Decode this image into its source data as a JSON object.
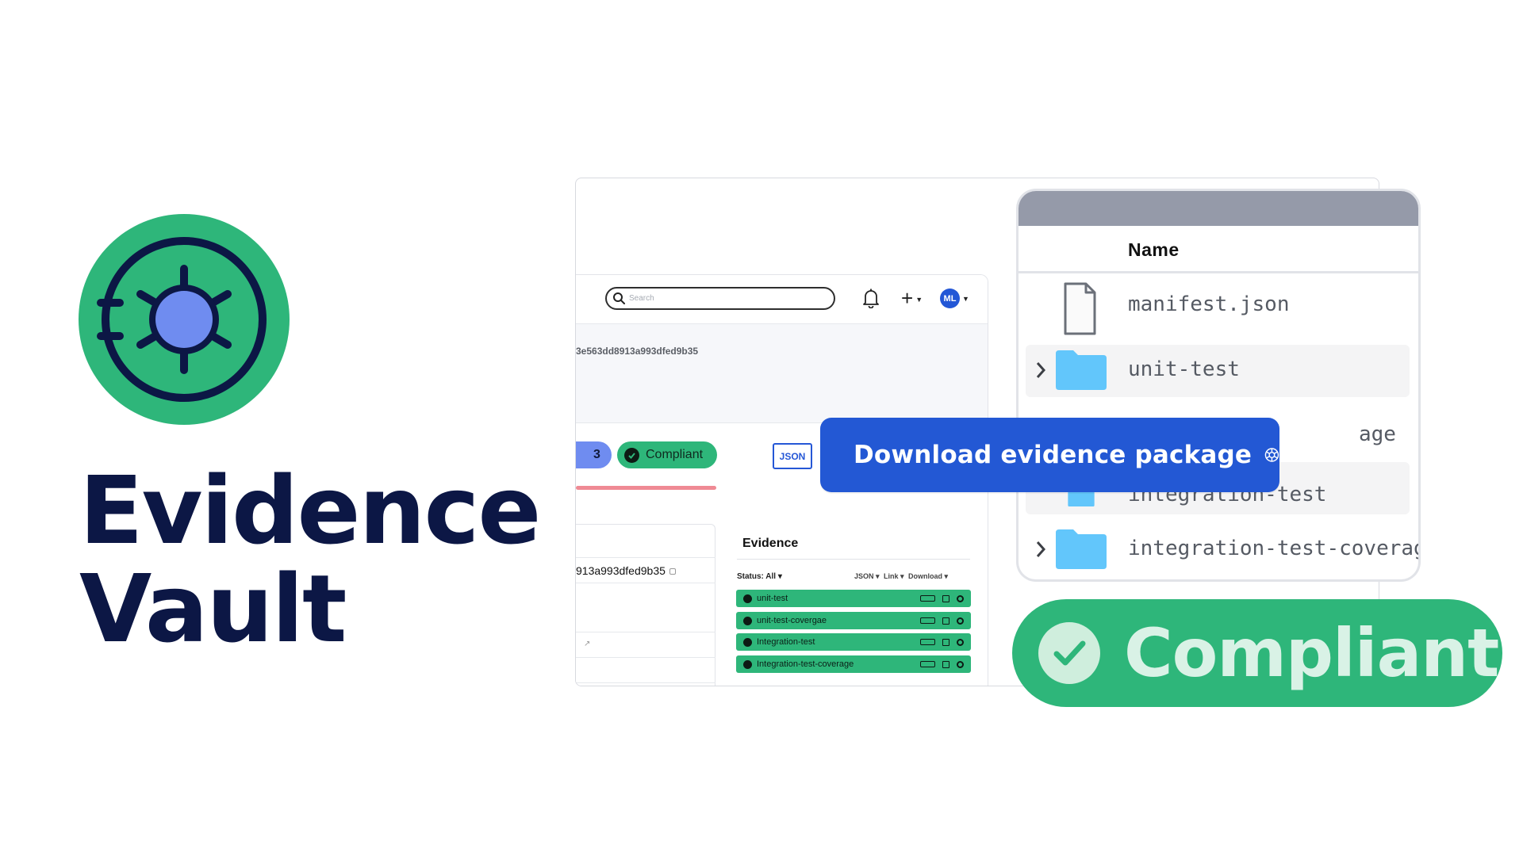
{
  "brand": {
    "title_line1": "Evidence",
    "title_line2": "Vault",
    "logo_icon": "vault-dial-icon",
    "colors": {
      "navy": "#0c1745",
      "green": "#2eb67a",
      "blue": "#2358d4",
      "periwinkle": "#6f8cf0"
    }
  },
  "app": {
    "search": {
      "placeholder": "Search"
    },
    "topbar": {
      "notifications_icon": "bell-icon",
      "add_icon": "plus-icon",
      "avatar_initials": "ML"
    },
    "commit_hash": "3e563dd8913a993dfed9b35",
    "badges": {
      "count": "3",
      "compliant": "Compliant"
    },
    "json_button": "JSON",
    "left_card": {
      "hash": "913a993dfed9b35"
    },
    "evidence": {
      "title": "Evidence",
      "status_filter": "Status: All",
      "filters": [
        "JSON",
        "Link",
        "Download"
      ],
      "items": [
        {
          "label": "unit-test"
        },
        {
          "label": "unit-test-covergae"
        },
        {
          "label": "Integration-test"
        },
        {
          "label": "Integration-test-coverage"
        }
      ]
    }
  },
  "file_browser": {
    "column_name": "Name",
    "rows": [
      {
        "name": "manifest.json",
        "type": "file"
      },
      {
        "name": "unit-test",
        "type": "folder"
      },
      {
        "name": "age",
        "type": "folder"
      },
      {
        "name": "integration-test",
        "type": "folder"
      },
      {
        "name": "integration-test-coverage",
        "type": "folder"
      }
    ]
  },
  "download_button": {
    "label": "Download evidence package",
    "icon": "gear-icon"
  },
  "status_pill": {
    "label": "Compliant",
    "icon": "check-icon"
  }
}
